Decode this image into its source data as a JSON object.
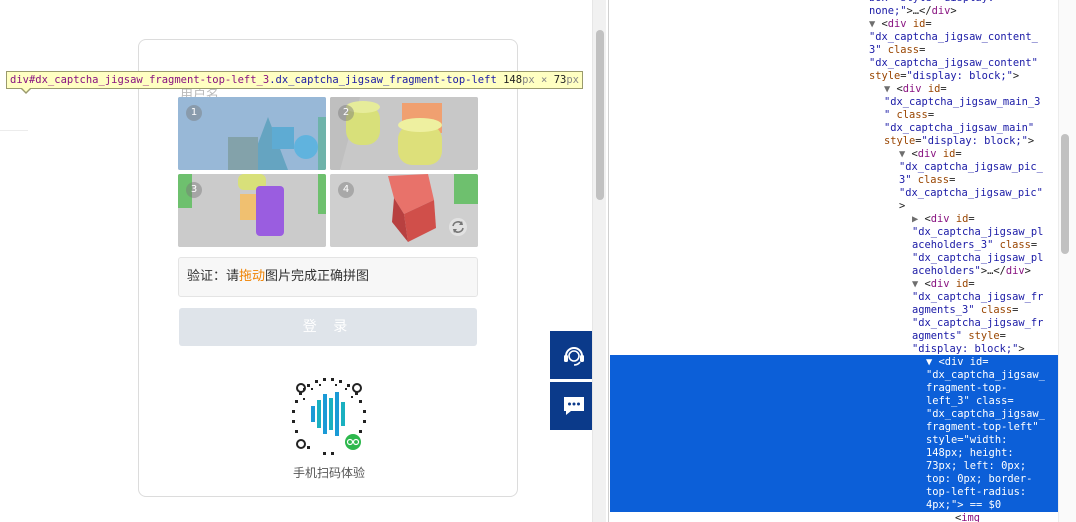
{
  "login": {
    "field_label": "用户名",
    "tiles": [
      "1",
      "2",
      "3",
      "4"
    ],
    "verify_prefix": "验证：请",
    "verify_highlight": "拖动",
    "verify_suffix": "图片完成正确拼图",
    "login_button": "登 录",
    "qr_label": "手机扫码体验"
  },
  "inspector_tooltip": {
    "selector_tag": "div#dx_captcha_jigsaw_fragment-top-left_3",
    "selector_class": ".dx_captcha_jigsaw_fragment-top-left",
    "width": "148",
    "height": "73",
    "unit": "px",
    "times": "×"
  },
  "floating_buttons": [
    {
      "icon": "customer-service-icon"
    },
    {
      "icon": "chat-icon"
    }
  ],
  "colors": {
    "verify_highlight": "#f08200",
    "side_button": "#0b3a8a",
    "devtools_selection": "#0c5fd8",
    "tag": "#881280",
    "attr": "#994500",
    "value": "#1a1aa6"
  },
  "devtools": {
    "lines": [
      {
        "indent": 0,
        "html": "<span class=\"v\">box\" style=\"display:</span>"
      },
      {
        "indent": 0,
        "html": "<span class=\"v\">none;\"</span>&gt;…&lt;/<span class=\"t\">div</span>&gt;"
      },
      {
        "indent": 0,
        "html": "<span class=\"tri\">▼</span> &lt;<span class=\"t\">div</span> <span class=\"a\">id</span>="
      },
      {
        "indent": 0,
        "html": "<span class=\"v\">\"dx_captcha_jigsaw_content_</span>"
      },
      {
        "indent": 0,
        "html": "<span class=\"v\">3\"</span> <span class=\"a\">class</span>="
      },
      {
        "indent": 0,
        "html": "<span class=\"v\">\"dx_captcha_jigsaw_content\"</span>"
      },
      {
        "indent": 0,
        "html": "<span class=\"a\">style</span>=<span class=\"v\">\"display: block;\"</span>&gt;"
      },
      {
        "indent": 1,
        "html": "<span class=\"tri\">▼</span> &lt;<span class=\"t\">div</span> <span class=\"a\">id</span>="
      },
      {
        "indent": 1,
        "html": "<span class=\"v\">\"dx_captcha_jigsaw_main_3</span>"
      },
      {
        "indent": 1,
        "html": "<span class=\"v\">\"</span> <span class=\"a\">class</span>="
      },
      {
        "indent": 1,
        "html": "<span class=\"v\">\"dx_captcha_jigsaw_main\"</span>"
      },
      {
        "indent": 1,
        "html": "<span class=\"a\">style</span>=<span class=\"v\">\"display: block;\"</span>&gt;"
      },
      {
        "indent": 2,
        "html": "<span class=\"tri\">▼</span> &lt;<span class=\"t\">div</span> <span class=\"a\">id</span>="
      },
      {
        "indent": 2,
        "html": "<span class=\"v\">\"dx_captcha_jigsaw_pic_</span>"
      },
      {
        "indent": 2,
        "html": "<span class=\"v\">3\"</span> <span class=\"a\">class</span>="
      },
      {
        "indent": 2,
        "html": "<span class=\"v\">\"dx_captcha_jigsaw_pic\"</span>"
      },
      {
        "indent": 2,
        "html": "&gt;"
      },
      {
        "indent": 3,
        "html": "<span class=\"tri\">▶</span> &lt;<span class=\"t\">div</span> <span class=\"a\">id</span>="
      },
      {
        "indent": 3,
        "html": "<span class=\"v\">\"dx_captcha_jigsaw_pl</span>"
      },
      {
        "indent": 3,
        "html": "<span class=\"v\">aceholders_3\"</span> <span class=\"a\">class</span>="
      },
      {
        "indent": 3,
        "html": "<span class=\"v\">\"dx_captcha_jigsaw_pl</span>"
      },
      {
        "indent": 3,
        "html": "<span class=\"v\">aceholders\"</span>&gt;…&lt;/<span class=\"t\">div</span>&gt;"
      },
      {
        "indent": 3,
        "html": "<span class=\"tri\">▼</span> &lt;<span class=\"t\">div</span> <span class=\"a\">id</span>="
      },
      {
        "indent": 3,
        "html": "<span class=\"v\">\"dx_captcha_jigsaw_fr</span>"
      },
      {
        "indent": 3,
        "html": "<span class=\"v\">agments_3\"</span> <span class=\"a\">class</span>="
      },
      {
        "indent": 3,
        "html": "<span class=\"v\">\"dx_captcha_jigsaw_fr</span>"
      },
      {
        "indent": 3,
        "html": "<span class=\"v\">agments\"</span> <span class=\"a\">style</span>="
      },
      {
        "indent": 3,
        "html": "<span class=\"v\">\"display: block;\"</span>&gt;"
      },
      {
        "indent": 4,
        "sel": true,
        "html": "▼ &lt;div id="
      },
      {
        "indent": 4,
        "sel": true,
        "html": "\"dx_captcha_jigsaw_"
      },
      {
        "indent": 4,
        "sel": true,
        "html": "fragment-top-"
      },
      {
        "indent": 4,
        "sel": true,
        "html": "left_3\" class="
      },
      {
        "indent": 4,
        "sel": true,
        "html": "\"dx_captcha_jigsaw_"
      },
      {
        "indent": 4,
        "sel": true,
        "html": "fragment-top-left\""
      },
      {
        "indent": 4,
        "sel": true,
        "html": "style=\"width:"
      },
      {
        "indent": 4,
        "sel": true,
        "html": "148px; height:"
      },
      {
        "indent": 4,
        "sel": true,
        "html": "73px; left: 0px;"
      },
      {
        "indent": 4,
        "sel": true,
        "html": "top: 0px; border-"
      },
      {
        "indent": 4,
        "sel": true,
        "html": "top-left-radius:"
      },
      {
        "indent": 4,
        "sel": true,
        "html": "4px;\"&gt; == $0"
      },
      {
        "indent": 5,
        "html": "&lt;<span class=\"t\">img</span>"
      }
    ]
  }
}
